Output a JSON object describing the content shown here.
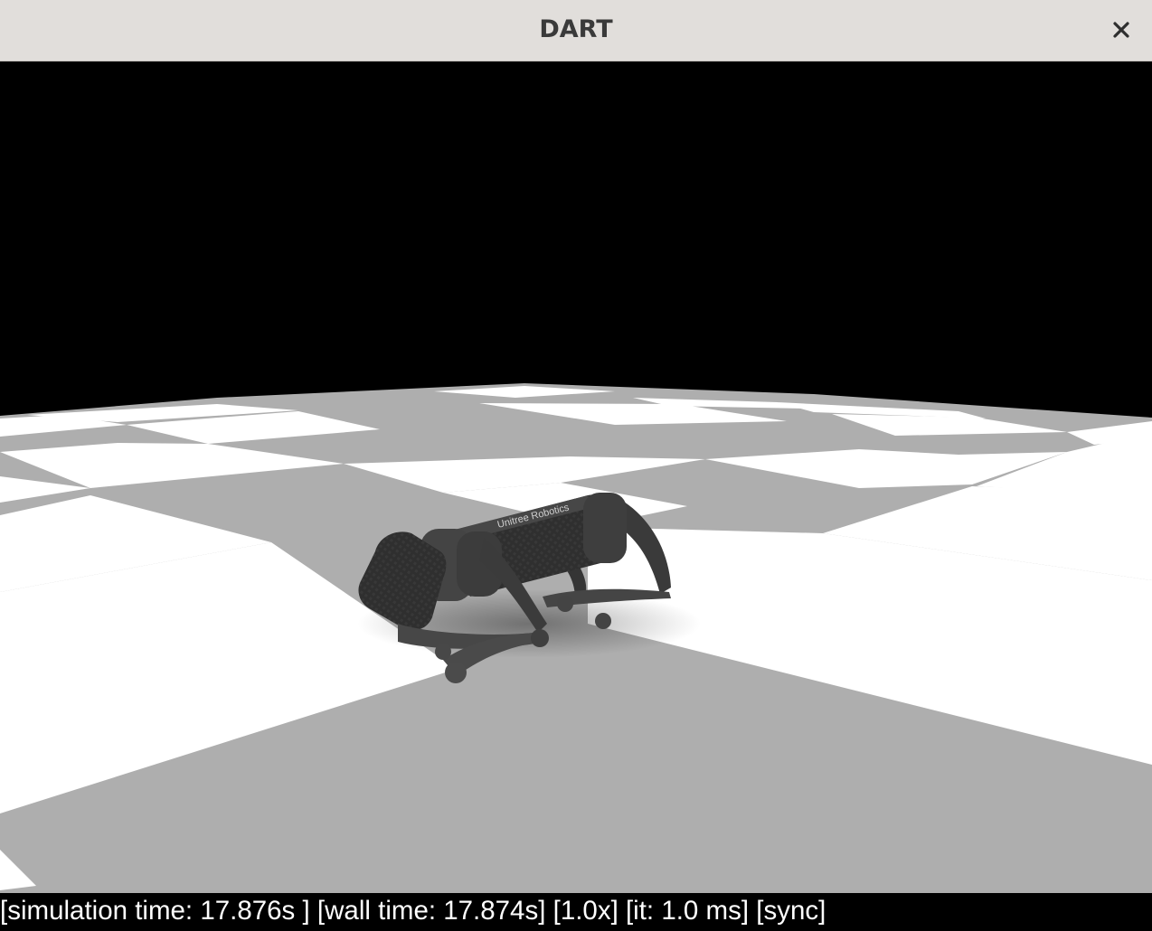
{
  "window": {
    "title": "DART",
    "close_icon": "close-icon"
  },
  "scene": {
    "background_color": "#000000",
    "floor_colors": [
      "#ffffff",
      "#aeaeae"
    ],
    "robot_label": "Unitree Robotics",
    "robot_color": "#3c3c3c"
  },
  "status": {
    "simulation_time": "[simulation time: 17.876s ]",
    "wall_time": "[wall time: 17.874s]",
    "speed": "[1.0x]",
    "iteration": "[it: 1.0 ms]",
    "sync": "[sync]"
  }
}
